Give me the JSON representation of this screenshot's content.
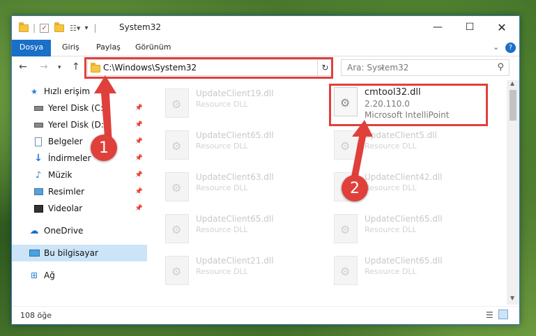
{
  "window": {
    "title": "System32"
  },
  "ribbon": {
    "tabs": [
      "Dosya",
      "Giriş",
      "Paylaş",
      "Görünüm"
    ]
  },
  "address": {
    "path": "C:\\Windows\\System32"
  },
  "search": {
    "placeholder": "Ara: System32"
  },
  "sidebar": {
    "items": [
      {
        "label": "Hızlı erişim",
        "icon": "star-icon"
      },
      {
        "label": "Yerel Disk (C:)",
        "icon": "drive-icon",
        "pinned": true
      },
      {
        "label": "Yerel Disk (D:)",
        "icon": "drive-icon",
        "pinned": true
      },
      {
        "label": "Belgeler",
        "icon": "documents-icon",
        "pinned": true
      },
      {
        "label": "İndirmeler",
        "icon": "downloads-icon",
        "pinned": true
      },
      {
        "label": "Müzik",
        "icon": "music-icon",
        "pinned": true
      },
      {
        "label": "Resimler",
        "icon": "pictures-icon",
        "pinned": true
      },
      {
        "label": "Videolar",
        "icon": "videos-icon",
        "pinned": true
      },
      {
        "label": "OneDrive",
        "icon": "cloud-icon"
      },
      {
        "label": "Bu bilgisayar",
        "icon": "computer-icon",
        "selected": true
      },
      {
        "label": "Ağ",
        "icon": "network-icon"
      }
    ]
  },
  "files": {
    "col1": [
      {
        "name": "UpdateClient19.dll",
        "type": "Resource DLL"
      },
      {
        "name": "UpdateClient65.dll",
        "type": "Resource DLL"
      },
      {
        "name": "UpdateClient63.dll",
        "type": "Resource DLL"
      },
      {
        "name": "UpdateClient65.dll",
        "type": "Resource DLL"
      },
      {
        "name": "UpdateClient21.dll",
        "type": "Resource DLL"
      }
    ],
    "col2": [
      {
        "name": "cmtool32.dll",
        "version": "2.20.110.0",
        "company": "Microsoft IntelliPoint"
      },
      {
        "name": "UpdateClient5.dll",
        "type": "Resource DLL"
      },
      {
        "name": "UpdateClient42.dll",
        "type": "Resource DLL"
      },
      {
        "name": "UpdateClient65.dll",
        "type": "Resource DLL"
      },
      {
        "name": "UpdateClient65.dll",
        "type": "Resource DLL"
      }
    ]
  },
  "status": {
    "count": "108 öğe"
  },
  "callouts": [
    "1",
    "2"
  ],
  "colors": {
    "accent": "#1a6fc6",
    "highlight": "#e0403a"
  }
}
